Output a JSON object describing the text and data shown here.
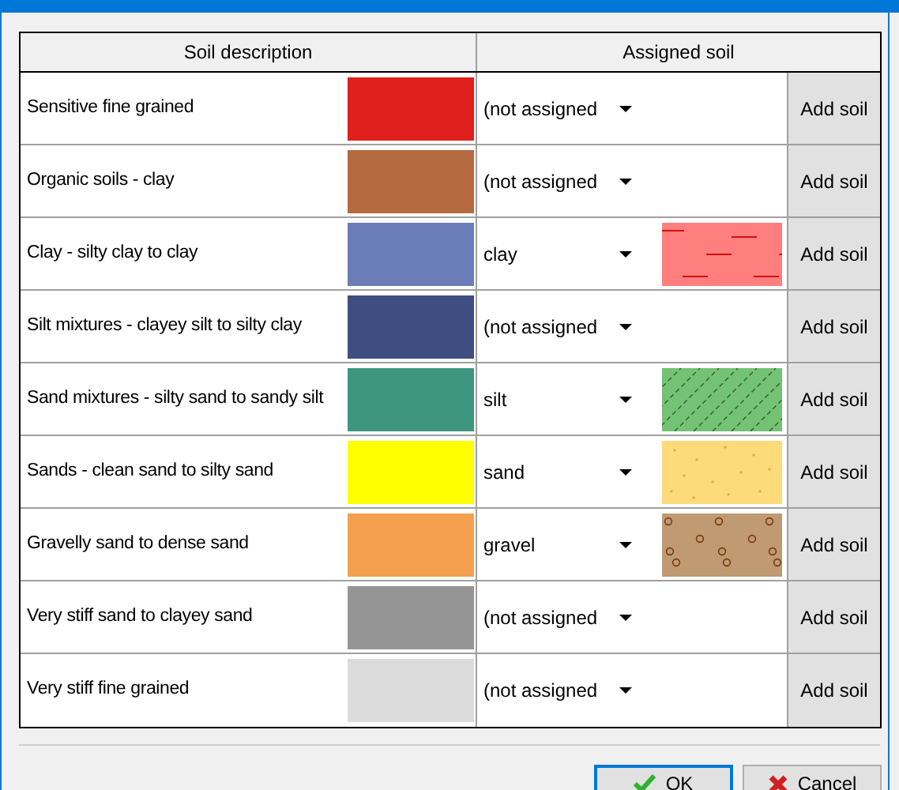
{
  "table": {
    "columns": [
      "Soil description",
      "Assigned soil"
    ],
    "rows": [
      {
        "description": "Sensitive fine grained",
        "color": "#e0201c",
        "assigned": "(not assigned",
        "kind": "none",
        "action": "Add soil"
      },
      {
        "description": "Organic soils - clay",
        "color": "#b56a40",
        "assigned": "(not assigned",
        "kind": "none",
        "action": "Add soil"
      },
      {
        "description": "Clay - silty clay to clay",
        "color": "#6a7db8",
        "assigned": "clay",
        "kind": "dashes",
        "action": "Add soil"
      },
      {
        "description": "Silt mixtures - clayey silt to silty clay",
        "color": "#3f4d80",
        "assigned": "(not assigned",
        "kind": "none",
        "action": "Add soil"
      },
      {
        "description": "Sand mixtures - silty sand to sandy silt",
        "color": "#3f9680",
        "assigned": "silt",
        "kind": "hatch",
        "action": "Add soil"
      },
      {
        "description": "Sands - clean sand to silty sand",
        "color": "#ffff00",
        "assigned": "sand",
        "kind": "dots",
        "action": "Add soil"
      },
      {
        "description": "Gravelly sand to dense sand",
        "color": "#f4a04f",
        "assigned": "gravel",
        "kind": "circles",
        "action": "Add soil"
      },
      {
        "description": "Very stiff sand to clayey sand",
        "color": "#959595",
        "assigned": "(not assigned",
        "kind": "none",
        "action": "Add soil"
      },
      {
        "description": "Very stiff fine grained",
        "color": "#dcdcdc",
        "assigned": "(not assigned",
        "kind": "none",
        "action": "Add soil"
      }
    ]
  },
  "buttons": [
    {
      "kind": "ok",
      "label": "OK"
    },
    {
      "kind": "cancel",
      "label": "Cancel"
    }
  ]
}
